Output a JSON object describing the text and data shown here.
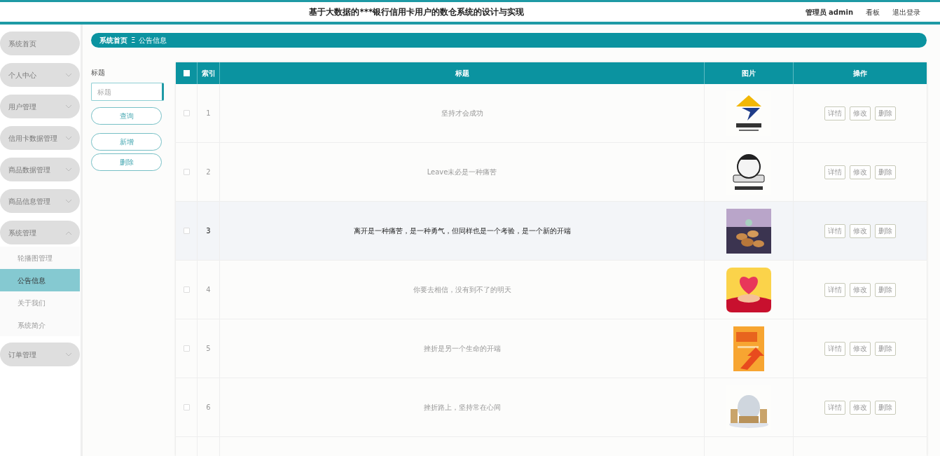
{
  "header": {
    "title": "基于大数据的***银行信用卡用户的数仓系统的设计与实现",
    "user": "管理员 admin",
    "links": [
      "看板",
      "退出登录"
    ]
  },
  "sidebar": {
    "items": [
      {
        "label": "系统首页",
        "kind": "link"
      },
      {
        "label": "个人中心",
        "kind": "menu",
        "expanded": false
      },
      {
        "label": "用户管理",
        "kind": "menu",
        "expanded": false
      },
      {
        "label": "信用卡数据管理",
        "kind": "menu",
        "expanded": false
      },
      {
        "label": "商品数据管理",
        "kind": "menu",
        "expanded": false
      },
      {
        "label": "商品信息管理",
        "kind": "menu",
        "expanded": false
      },
      {
        "label": "系统管理",
        "kind": "menu",
        "expanded": true,
        "children": [
          {
            "label": "轮播图管理",
            "selected": false
          },
          {
            "label": "公告信息",
            "selected": true
          },
          {
            "label": "关于我们",
            "selected": false
          },
          {
            "label": "系统简介",
            "selected": false
          }
        ]
      },
      {
        "label": "订单管理",
        "kind": "menu",
        "expanded": false
      }
    ]
  },
  "breadcrumb": {
    "items": [
      "系统首页",
      "公告信息"
    ],
    "separator": "Ξ"
  },
  "filter": {
    "label": "标题",
    "placeholder": "标题",
    "buttons": [
      "查询",
      "新增",
      "删除"
    ]
  },
  "table": {
    "columns": [
      "索引",
      "标题",
      "图片",
      "操作"
    ],
    "header_checked": false,
    "rows": [
      {
        "index": "1",
        "title": "坚持才会成功",
        "checked": false,
        "highlighted": false,
        "actions": [
          "详情",
          "修改",
          "删除"
        ]
      },
      {
        "index": "2",
        "title": "Leave未必是一种痛苦",
        "checked": false,
        "highlighted": false,
        "actions": [
          "详情",
          "修改",
          "删除"
        ]
      },
      {
        "index": "3",
        "title": "离开是一种痛苦，是一种勇气，但同样也是一个考验，是一个新的开端",
        "checked": false,
        "highlighted": true,
        "actions": [
          "详情",
          "修改",
          "删除"
        ]
      },
      {
        "index": "4",
        "title": "你要去相信，没有到不了的明天",
        "checked": false,
        "highlighted": false,
        "actions": [
          "详情",
          "修改",
          "删除"
        ]
      },
      {
        "index": "5",
        "title": "挫折是另一个生命的开端",
        "checked": false,
        "highlighted": false,
        "actions": [
          "详情",
          "修改",
          "删除"
        ]
      },
      {
        "index": "6",
        "title": "挫折路上，坚持常在心间",
        "checked": false,
        "highlighted": false,
        "actions": [
          "详情",
          "修改",
          "删除"
        ]
      }
    ]
  }
}
